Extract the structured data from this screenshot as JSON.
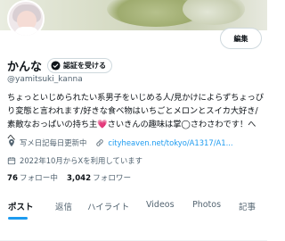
{
  "profile": {
    "display_name": "かんな",
    "handle": "@yamitsuki_kanna",
    "verify_label": "認証を受ける",
    "edit_label": "編集",
    "bio_part1": "ちょっといじめられたい系男子をいじめる人/見かけによらずちょっぴり変態と言われます/好きな食べ物はいちごとメロンとスイカ大好き/素敵なおっぱいの持ち主",
    "bio_heart": "💗",
    "bio_part2": "さいきんの趣味は掌◯さわさわです！へへ",
    "location": "写メ日記毎日更新中",
    "website": "cityheaven.net/tokyo/A1317/A1...",
    "joined": "2022年10月からXを利用しています",
    "following_count": "76",
    "following_label": "フォロー中",
    "followers_count": "3,042",
    "followers_label": "フォロワー"
  },
  "tabs": [
    "ポスト",
    "返信",
    "ハイライト",
    "Videos",
    "Photos",
    "記事"
  ],
  "colors": {
    "accent": "#1d9bf0",
    "text": "#0f1419",
    "muted": "#536471"
  }
}
